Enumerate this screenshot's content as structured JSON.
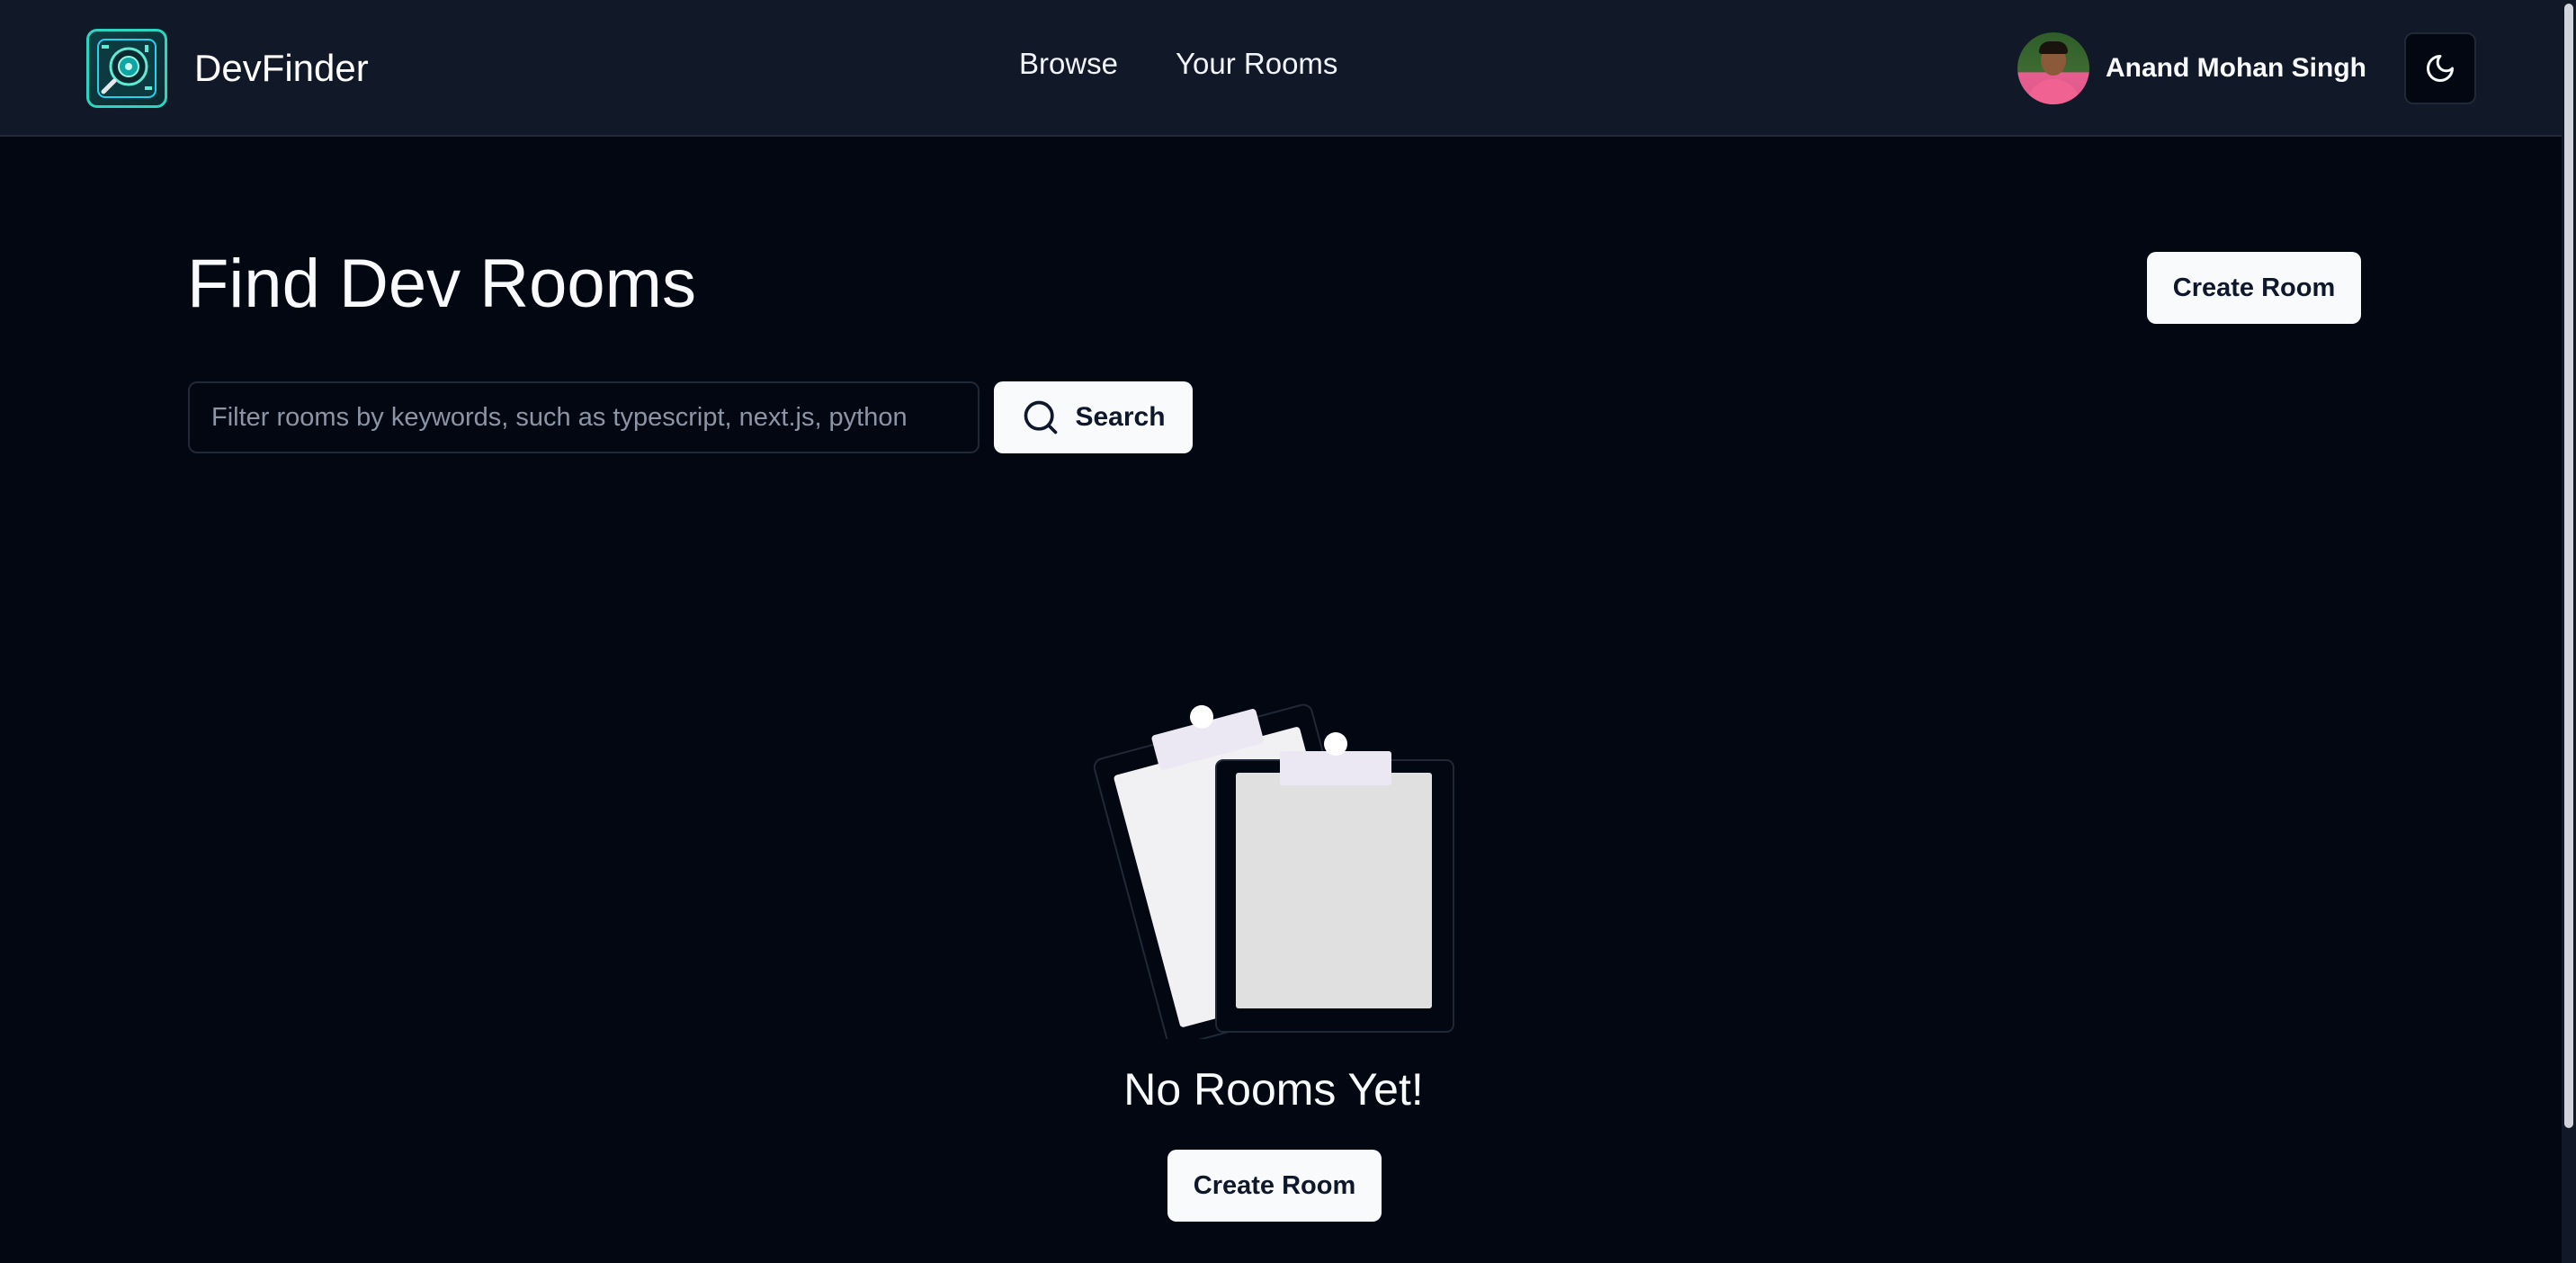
{
  "header": {
    "brand": "DevFinder",
    "nav": [
      {
        "label": "Browse"
      },
      {
        "label": "Your Rooms"
      }
    ],
    "user_name": "Anand Mohan Singh"
  },
  "main": {
    "title": "Find Dev Rooms",
    "create_room_label": "Create Room",
    "search": {
      "placeholder": "Filter rooms by keywords, such as typescript, next.js, python",
      "button_label": "Search"
    },
    "empty_state": {
      "title": "No Rooms Yet!",
      "create_room_label": "Create Room"
    }
  },
  "icons": {
    "logo": "devfinder-logo-icon",
    "theme_toggle": "moon-icon",
    "search": "search-icon",
    "empty": "clipboards-illustration"
  }
}
